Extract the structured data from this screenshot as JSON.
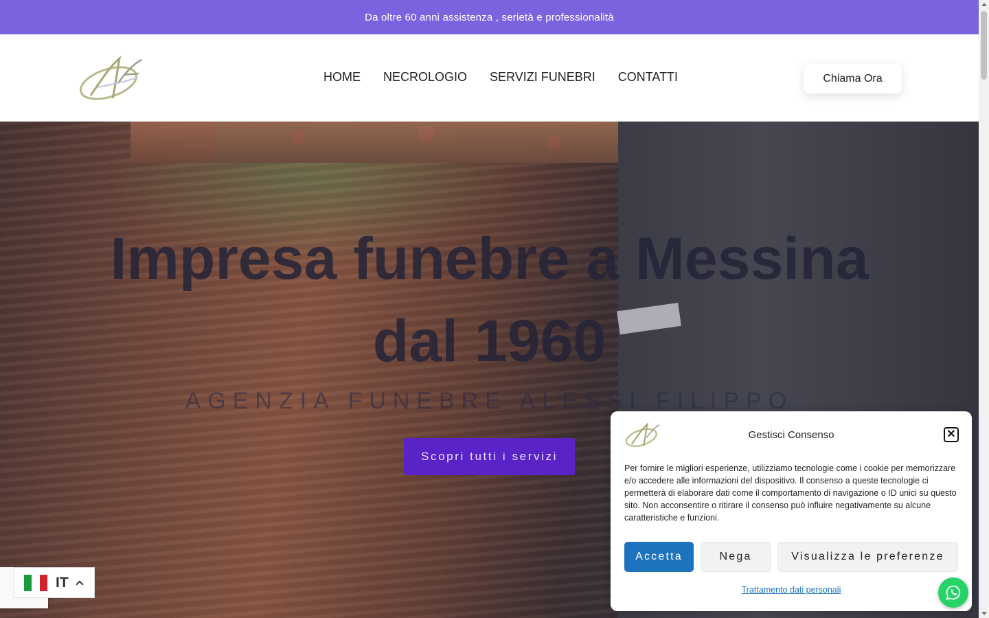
{
  "topbar": {
    "text": "Da oltre 60 anni assistenza , serietà e professionalità",
    "color": "#7b63e0"
  },
  "header": {
    "logo_icon": "af-monogram-logo",
    "nav": [
      "HOME",
      "NECROLOGIO",
      "SERVIZI FUNEBRI",
      "CONTATTI"
    ],
    "call_button": "Chiama Ora"
  },
  "hero": {
    "title_line1": "Impresa funebre a Messina",
    "title_line2": "dal 1960",
    "subtitle": "AGENZIA FUNEBRE ALESSI FILIPPO",
    "button": "Scopri tutti i servizi",
    "button_color": "#5a23c8"
  },
  "consent": {
    "title": "Gestisci Consenso",
    "text": "Per fornire le migliori esperienze, utilizziamo tecnologie come i cookie per memorizzare e/o accedere alle informazioni del dispositivo. Il consenso a queste tecnologie ci permetterà di elaborare dati come il comportamento di navigazione o ID unici su questo sito. Non acconsentire o ritirare il consenso può influire negativamente su alcune caratteristiche e funzioni.",
    "accept": "Accetta",
    "deny": "Nega",
    "preferences": "Visualizza le preferenze",
    "privacy_link": "Trattamento dati personali",
    "accent": "#1e73be"
  },
  "language": {
    "code": "IT",
    "flag_icon": "italy-flag-icon"
  },
  "whatsapp": {
    "icon": "whatsapp-icon",
    "color": "#25d366"
  }
}
